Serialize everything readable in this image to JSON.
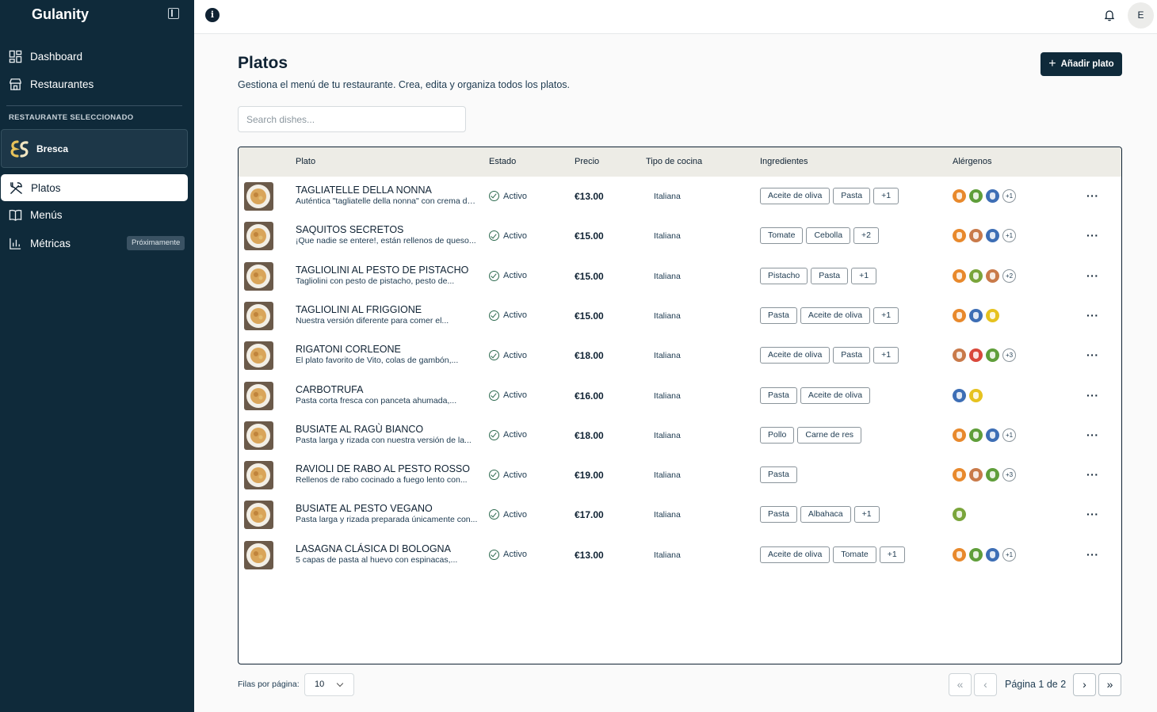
{
  "app": {
    "brand": "Gulanity"
  },
  "sidebar": {
    "nav": [
      {
        "label": "Dashboard",
        "icon": "dashboard-icon"
      },
      {
        "label": "Restaurantes",
        "icon": "store-icon"
      }
    ],
    "section_label": "RESTAURANTE SELECCIONADO",
    "restaurant": {
      "name": "Bresca",
      "logo_icon": "bresca-logo"
    },
    "sub_nav": [
      {
        "label": "Platos",
        "icon": "utensils-icon",
        "active": true
      },
      {
        "label": "Menús",
        "icon": "book-icon"
      },
      {
        "label": "Métricas",
        "icon": "bar-chart-icon",
        "badge": "Próximamente"
      }
    ]
  },
  "topbar": {
    "avatar_initial": "E"
  },
  "main": {
    "title": "Platos",
    "subtitle": "Gestiona el menú de tu restaurante. Crea, edita y organiza todos los platos.",
    "add_button": "Añadir plato",
    "search_placeholder": "Search dishes...",
    "columns": [
      "Plato",
      "Estado",
      "Precio",
      "Tipo de cocina",
      "Ingredientes",
      "Alérgenos"
    ],
    "rows": [
      {
        "name": "TAGLIATELLE DELLA NONNA",
        "desc": "Auténtica \"tagliatelle della nonna\" con crema de...",
        "status": "Activo",
        "price": "€13.00",
        "cuisine": "Italiana",
        "ingredients": [
          "Aceite de oliva",
          "Pasta",
          "+1"
        ],
        "allergens": [
          "#e8892c",
          "#5f9e3a",
          "#3d6eb5"
        ],
        "allergens_more": "+1"
      },
      {
        "name": "SAQUITOS SECRETOS",
        "desc": "¡Que nadie se entere!, están rellenos de queso...",
        "status": "Activo",
        "price": "€15.00",
        "cuisine": "Italiana",
        "ingredients": [
          "Tomate",
          "Cebolla",
          "+2"
        ],
        "allergens": [
          "#e8892c",
          "#c97a4a",
          "#3d6eb5"
        ],
        "allergens_more": "+1"
      },
      {
        "name": "TAGLIOLINI AL PESTO DE PISTACHO",
        "desc": "Tagliolini con pesto de pistacho, pesto de...",
        "status": "Activo",
        "price": "€15.00",
        "cuisine": "Italiana",
        "ingredients": [
          "Pistacho",
          "Pasta",
          "+1"
        ],
        "allergens": [
          "#e8892c",
          "#7aa53b",
          "#c97a4a"
        ],
        "allergens_more": "+2"
      },
      {
        "name": "TAGLIOLINI AL FRIGGIONE",
        "desc": "Nuestra versión diferente para comer el...",
        "status": "Activo",
        "price": "€15.00",
        "cuisine": "Italiana",
        "ingredients": [
          "Pasta",
          "Aceite de oliva",
          "+1"
        ],
        "allergens": [
          "#e8892c",
          "#3d6eb5",
          "#e6c21f"
        ],
        "allergens_more": ""
      },
      {
        "name": "RIGATONI CORLEONE",
        "desc": "El plato favorito de Vito, colas de gambón,...",
        "status": "Activo",
        "price": "€18.00",
        "cuisine": "Italiana",
        "ingredients": [
          "Aceite de oliva",
          "Pasta",
          "+1"
        ],
        "allergens": [
          "#c97a4a",
          "#d9483b",
          "#5f9e3a"
        ],
        "allergens_more": "+3"
      },
      {
        "name": "CARBOTRUFA",
        "desc": "Pasta corta fresca con panceta ahumada,...",
        "status": "Activo",
        "price": "€16.00",
        "cuisine": "Italiana",
        "ingredients": [
          "Pasta",
          "Aceite de oliva"
        ],
        "allergens": [
          "#3d6eb5",
          "#e6c21f"
        ],
        "allergens_more": ""
      },
      {
        "name": "BUSIATE AL RAGÙ BIANCO",
        "desc": "Pasta larga y rizada con nuestra versión de la...",
        "status": "Activo",
        "price": "€18.00",
        "cuisine": "Italiana",
        "ingredients": [
          "Pollo",
          "Carne de res"
        ],
        "allergens": [
          "#e8892c",
          "#5f9e3a",
          "#3d6eb5"
        ],
        "allergens_more": "+1"
      },
      {
        "name": "RAVIOLI DE RABO AL PESTO ROSSO",
        "desc": "Rellenos de rabo cocinado a fuego lento con...",
        "status": "Activo",
        "price": "€19.00",
        "cuisine": "Italiana",
        "ingredients": [
          "Pasta"
        ],
        "allergens": [
          "#e8892c",
          "#c97a4a",
          "#5f9e3a"
        ],
        "allergens_more": "+3"
      },
      {
        "name": "BUSIATE AL PESTO VEGANO",
        "desc": "Pasta larga y rizada preparada únicamente con...",
        "status": "Activo",
        "price": "€17.00",
        "cuisine": "Italiana",
        "ingredients": [
          "Pasta",
          "Albahaca",
          "+1"
        ],
        "allergens": [
          "#7aa53b"
        ],
        "allergens_more": ""
      },
      {
        "name": "LASAGNA CLÁSICA DI BOLOGNA",
        "desc": "5 capas de pasta al huevo con espinacas,...",
        "status": "Activo",
        "price": "€13.00",
        "cuisine": "Italiana",
        "ingredients": [
          "Aceite de oliva",
          "Tomate",
          "+1"
        ],
        "allergens": [
          "#e8892c",
          "#5f9e3a",
          "#3d6eb5"
        ],
        "allergens_more": "+1"
      }
    ]
  },
  "footer": {
    "rows_label": "Filas por página:",
    "rows_value": "10",
    "page_text": "Página 1 de 2"
  }
}
